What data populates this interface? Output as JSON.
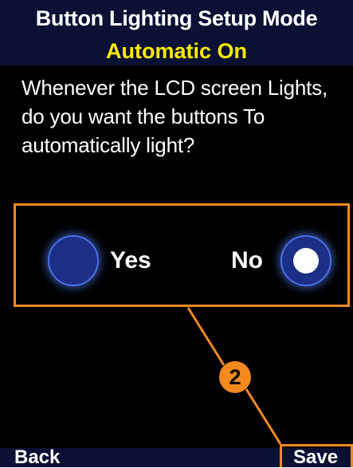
{
  "header": {
    "title": "Button Lighting Setup Mode",
    "subtitle": "Automatic On"
  },
  "question": "Whenever the LCD screen Lights, do you want the buttons To automatically light?",
  "options": [
    {
      "label": "Yes",
      "selected": false
    },
    {
      "label": "No",
      "selected": true
    }
  ],
  "footer": {
    "back_label": "Back",
    "save_label": "Save"
  },
  "callout": {
    "number": "2"
  },
  "colors": {
    "bar_background": "#0b1134",
    "subtitle_text": "#ffeb00",
    "highlight_orange": "#f38a1e",
    "radio_fill": "#1c2f86",
    "screen_background": "#000000"
  }
}
